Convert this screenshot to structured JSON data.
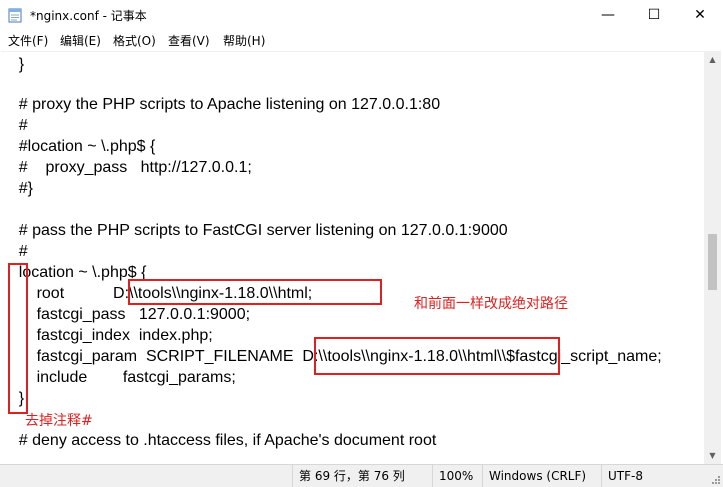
{
  "window": {
    "title": "*nginx.conf - 记事本",
    "controls": {
      "minimize": "—",
      "maximize": "☐",
      "close": "✕"
    }
  },
  "menu": [
    "文件(F)",
    "编辑(E)",
    "格式(O)",
    "查看(V)",
    "帮助(H)"
  ],
  "editor_lines": [
    "    }",
    "",
    "    # proxy the PHP scripts to Apache listening on 127.0.0.1:80",
    "    #",
    "    #location ~ \\.php$ {",
    "    #    proxy_pass   http://127.0.0.1;",
    "    #}",
    "",
    "    # pass the PHP scripts to FastCGI server listening on 127.0.0.1:9000",
    "    #",
    "    location ~ \\.php$ {",
    "        root           D:\\\\tools\\\\nginx-1.18.0\\\\html;",
    "        fastcgi_pass   127.0.0.1:9000;",
    "        fastcgi_index  index.php;",
    "        fastcgi_param  SCRIPT_FILENAME  D:\\\\tools\\\\nginx-1.18.0\\\\html\\\\$fastcgi_script_name;",
    "        include        fastcgi_params;",
    "    }",
    "    # deny access to .htaccess files, if Apache's document root"
  ],
  "annotations": {
    "note_absolute_path": "和前面一样改成绝对路径",
    "note_remove_comment": "去掉注释#"
  },
  "statusbar": {
    "position": "第 69 行，第 76 列",
    "zoom": "100%",
    "line_ending": "Windows (CRLF)",
    "encoding": "UTF-8"
  },
  "colors": {
    "annotation_red": "#e02020"
  }
}
